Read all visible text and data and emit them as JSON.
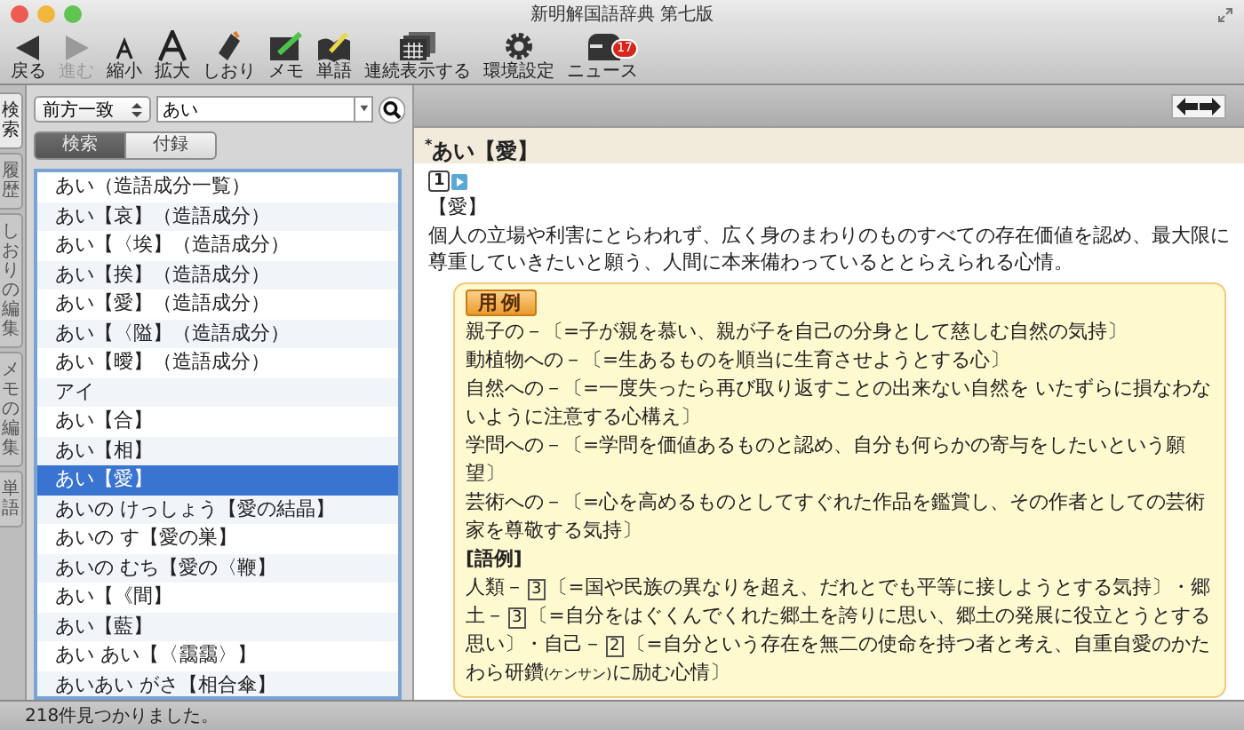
{
  "window": {
    "title": "新明解国語辞典 第七版"
  },
  "toolbar": [
    {
      "label": "戻る",
      "kind": "back",
      "disabled": false
    },
    {
      "label": "進む",
      "kind": "forward",
      "disabled": true
    },
    {
      "label": "縮小",
      "kind": "shrink",
      "disabled": false
    },
    {
      "label": "拡大",
      "kind": "enlarge",
      "disabled": false
    },
    {
      "label": "しおり",
      "kind": "bookmark",
      "disabled": false
    },
    {
      "label": "メモ",
      "kind": "memo",
      "disabled": false
    },
    {
      "label": "単語",
      "kind": "words",
      "disabled": false
    },
    {
      "label": "連続表示する",
      "kind": "continuous",
      "disabled": false
    },
    {
      "label": "環境設定",
      "kind": "settings",
      "disabled": false
    },
    {
      "label": "ニュース",
      "kind": "news",
      "disabled": false,
      "badge": "17"
    }
  ],
  "side_tabs": [
    {
      "label": "検索",
      "selected": true
    },
    {
      "label": "履歴",
      "selected": false
    },
    {
      "label": "しおりの編集",
      "selected": false
    },
    {
      "label": "メモの編集",
      "selected": false
    },
    {
      "label": "単語",
      "selected": false
    }
  ],
  "search": {
    "mode": "前方一致",
    "value": "あい"
  },
  "search_tabs": [
    {
      "label": "検索",
      "selected": true
    },
    {
      "label": "付録",
      "selected": false
    }
  ],
  "results": [
    {
      "text": "あい（造語成分一覧）",
      "selected": false
    },
    {
      "text": "あい【哀】（造語成分）",
      "selected": false
    },
    {
      "text": "あい【〈埃】（造語成分）",
      "selected": false
    },
    {
      "text": "あい【挨】（造語成分）",
      "selected": false
    },
    {
      "text": "あい【愛】（造語成分）",
      "selected": false
    },
    {
      "text": "あい【〈隘】（造語成分）",
      "selected": false
    },
    {
      "text": "あい【曖】（造語成分）",
      "selected": false
    },
    {
      "text": "アイ",
      "selected": false
    },
    {
      "text": "あい【合】",
      "selected": false
    },
    {
      "text": "あい【相】",
      "selected": false
    },
    {
      "text": "あい【愛】",
      "selected": true
    },
    {
      "text": "あいの けっしょう【愛の結晶】",
      "selected": false
    },
    {
      "text": "あいの す【愛の巣】",
      "selected": false
    },
    {
      "text": "あいの むち【愛の〈鞭】",
      "selected": false
    },
    {
      "text": "あい【《間】",
      "selected": false
    },
    {
      "text": "あい【藍】",
      "selected": false
    },
    {
      "text": "あい あい【〈靄靄〉】",
      "selected": false
    },
    {
      "text": "あいあい がさ【相合傘】",
      "selected": false
    }
  ],
  "entry": {
    "headword": "$^{*}$あい【愛】",
    "sense_number": "1",
    "kanji": "【愛】",
    "definition": "個人の立場や利害にとらわれず、広く身のまわりのものすべての存在価値を認め、最大限に尊重していきたいと願う、人間に本来備わっているととらえられる心情。",
    "examples_badge": "用例",
    "examples": [
      "親子の－〔=子が親を慕い、親が子を自己の分身として慈しむ自然の気持〕",
      "動植物への－〔=生あるものを順当に生育させようとする心〕",
      "自然への－〔=一度失ったら再び取り返すことの出来ない自然を いたずらに損なわないように注意する心構え〕",
      "学問への－〔=学問を価値あるものと認め、自分も何らかの寄与をしたいという願望〕",
      "芸術への－〔=心を高めるものとしてすぐれた作品を鑑賞し、その作者としての芸術家を尊敬する気持〕"
    ],
    "compounds_heading": "[語例]",
    "compounds": [
      {
        "word": "人類－",
        "number": "3",
        "gloss": "〔=国や民族の異なりを超え、だれとでも平等に接しようとする気持〕・"
      },
      {
        "word": "郷土－",
        "number": "3",
        "gloss": "〔=自分をはぐくんでくれた郷土を誇りに思い、郷土の発展に役立とうとする思い〕・"
      },
      {
        "word": "自己－",
        "number": "2",
        "gloss": "〔=自分という存在を無二の使命を持つ者と考え、自重自愛のかたわら研鑽",
        "reading": "(ケンサン)",
        "after": "に励む心情〕"
      }
    ]
  },
  "status_bar": "218件見つかりました。"
}
